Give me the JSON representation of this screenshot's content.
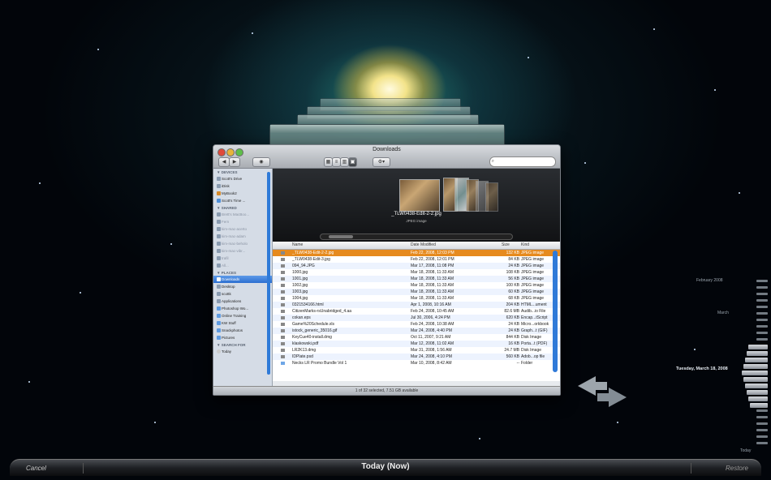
{
  "background": {
    "name": "Time Machine space"
  },
  "finder": {
    "title": "Downloads",
    "search_placeholder": "",
    "toolbar": {
      "back": "◀",
      "forward": "▶",
      "eye": "◉",
      "gear": "⚙▾"
    },
    "sidebar": {
      "devices_header": "▼ DEVICES",
      "devices": [
        "Scott's Drive",
        "iDisk",
        "MyBook2",
        "Scott's Time ..."
      ],
      "shared_header": "▼ SHARED",
      "shared": [
        "Brett's MacBoo...",
        "Fern",
        "kim-mac-acerto",
        "kim-mac-adam",
        "kim-mac-beholo",
        "kim-mac-vibr...",
        "trafil",
        "All..."
      ],
      "places_header": "▼ PLACES",
      "places": [
        "Downloads",
        "Desktop",
        "scottk",
        "Applications",
        "Photoshop Wo...",
        "Online Training",
        "KW Stuff",
        "Snackphotos",
        "Pictures"
      ],
      "search_header": "▼ SEARCH FOR",
      "search": [
        "Today"
      ]
    },
    "coverflow": {
      "caption": "_TLW0438-Edit-2-2.jpg",
      "subcaption": "JPEG image"
    },
    "columns": {
      "name": "Name",
      "date": "Date Modified",
      "size": "Size",
      "kind": "Kind"
    },
    "files": [
      {
        "name": "_TLW0438-Edit-2-2.jpg",
        "date": "Feb 22, 2008, 12:03 PM",
        "size": "132 KB",
        "kind": "JPEG image"
      },
      {
        "name": "_TLW0438-Edit-3.jpg",
        "date": "Feb 22, 2008, 12:01 PM",
        "size": "84 KB",
        "kind": "JPEG image"
      },
      {
        "name": "094_94.JPG",
        "date": "Mar 17, 2008, 11:08 PM",
        "size": "24 KB",
        "kind": "JPEG image"
      },
      {
        "name": "1000.jpg",
        "date": "Mar 18, 2008, 11:33 AM",
        "size": "108 KB",
        "kind": "JPEG image"
      },
      {
        "name": "1001.jpg",
        "date": "Mar 18, 2008, 11:33 AM",
        "size": "56 KB",
        "kind": "JPEG image"
      },
      {
        "name": "1002.jpg",
        "date": "Mar 18, 2008, 11:33 AM",
        "size": "100 KB",
        "kind": "JPEG image"
      },
      {
        "name": "1003.jpg",
        "date": "Mar 18, 2008, 11:33 AM",
        "size": "60 KB",
        "kind": "JPEG image"
      },
      {
        "name": "1004.jpg",
        "date": "Mar 18, 2008, 11:33 AM",
        "size": "68 KB",
        "kind": "JPEG image"
      },
      {
        "name": "0321534166.html",
        "date": "Apr 1, 2008, 10:16 AM",
        "size": "204 KB",
        "kind": "HTML...ument"
      },
      {
        "name": "CitizenMarks-rsUnabridged_4.aa",
        "date": "Feb 24, 2008, 10:45 AM",
        "size": "82.6 MB",
        "kind": "Audib...io File"
      },
      {
        "name": "cokan.eps",
        "date": "Jul 30, 2006, 4:24 PM",
        "size": "620 KB",
        "kind": "Encap...tScript"
      },
      {
        "name": "Game%20Schedule.xls",
        "date": "Feb 24, 2008, 10:38 AM",
        "size": "24 KB",
        "kind": "Micro...orkbook"
      },
      {
        "name": "istock_generic_35016.gif",
        "date": "Mar 24, 2008, 4:40 PM",
        "size": "24 KB",
        "kind": "Graph...t (GIF)"
      },
      {
        "name": "KeyCue40-install.dmg",
        "date": "Oct 11, 2007, 9:21 AM",
        "size": "844 KB",
        "kind": "Disk Image"
      },
      {
        "name": "klaskowski.pdf",
        "date": "Mar 12, 2008, 11:02 AM",
        "size": "16 KB",
        "kind": "Porta...t (PDF)"
      },
      {
        "name": "LR2K13.dmg",
        "date": "Mar 31, 2008, 1:56 AM",
        "size": "24.7 MB",
        "kind": "Disk Image"
      },
      {
        "name": "IDPlate.psd",
        "date": "Mar 24, 2008, 4:10 PM",
        "size": "560 KB",
        "kind": "Adob...op file"
      },
      {
        "name": "Necks LR Promo Bundle Vol 1",
        "date": "Mar 10, 2008, 8:42 AM",
        "size": "--",
        "kind": "Folder"
      }
    ],
    "status": "1 of 32 selected, 7.51 GB available"
  },
  "timeline": {
    "labels": [
      "February 2008",
      "March"
    ],
    "current_date": "Tuesday, March 18, 2008",
    "bottom_label": "Today"
  },
  "bottom": {
    "cancel": "Cancel",
    "center": "Today (Now)",
    "restore": "Restore"
  }
}
